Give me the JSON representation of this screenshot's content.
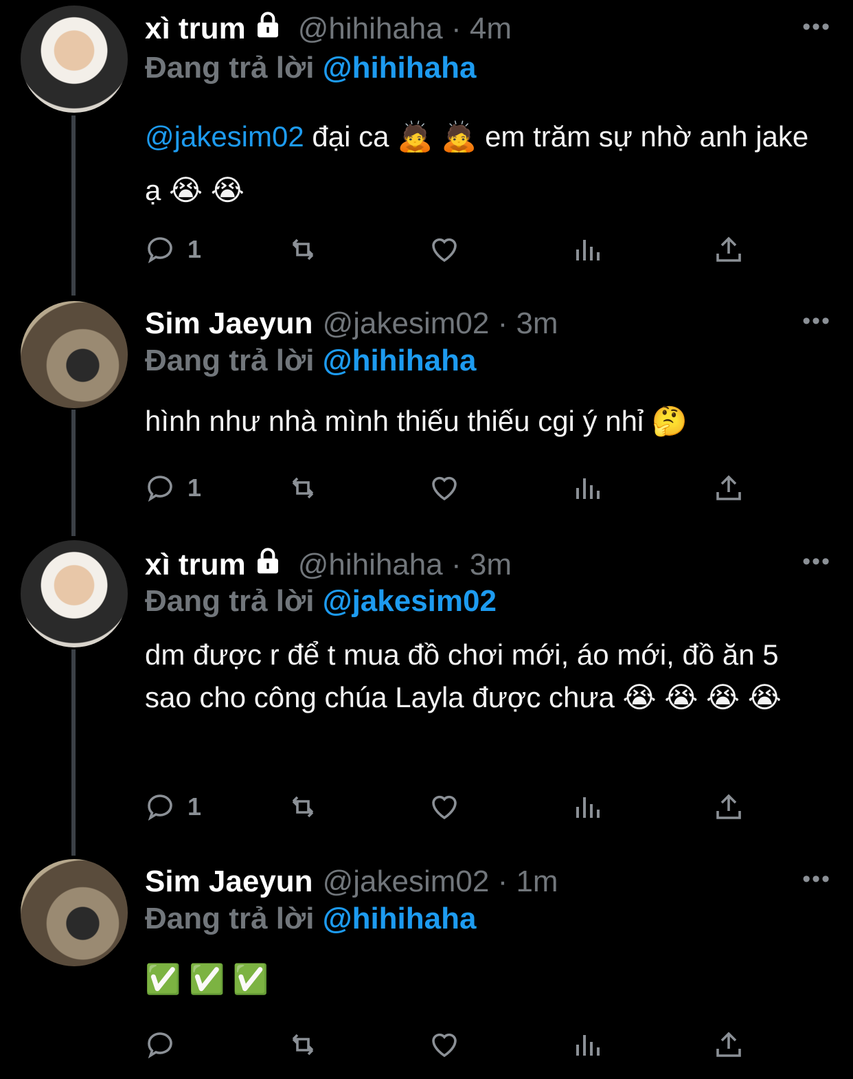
{
  "tweets": [
    {
      "name": "xì trum",
      "handle": "@hihihaha",
      "time": "4m",
      "reply_prefix": "Đang trả lời",
      "reply_to": "@hihihaha",
      "body_mention": "@jakesim02",
      "body_text": "đại ca 🙇 🙇  em trăm sự nhờ anh jake ạ 😭 😭",
      "reply_count": "1",
      "locked": true
    },
    {
      "name": "Sim Jaeyun",
      "handle": "@jakesim02",
      "time": "3m",
      "reply_prefix": "Đang trả lời",
      "reply_to": "@hihihaha",
      "body_text": "hình như nhà mình thiếu thiếu cgi ý nhỉ 🤔",
      "reply_count": "1"
    },
    {
      "name": "xì trum",
      "handle": "@hihihaha",
      "time": "3m",
      "reply_prefix": "Đang trả lời",
      "reply_to": "@jakesim02",
      "body_text": "dm được r để t mua đồ chơi mới, áo mới, đồ ăn 5 sao cho công chúa Layla được chưa 😭 😭 😭 😭",
      "reply_count": "1",
      "locked": true
    },
    {
      "name": "Sim Jaeyun",
      "handle": "@jakesim02",
      "time": "1m",
      "reply_prefix": "Đang trả lời",
      "reply_to": "@hihihaha",
      "body_text": "✅ ✅ ✅",
      "reply_count": ""
    }
  ],
  "icons": {
    "reply": "reply-icon",
    "retweet": "retweet-icon",
    "like": "heart-icon",
    "views": "views-icon",
    "share": "share-icon",
    "lock": "lock-icon",
    "more": "more-icon"
  },
  "meta_separator": "·",
  "more_glyph": "•••",
  "colors": {
    "accent": "#1d9bf0",
    "muted": "#71767b",
    "background": "#000000"
  }
}
